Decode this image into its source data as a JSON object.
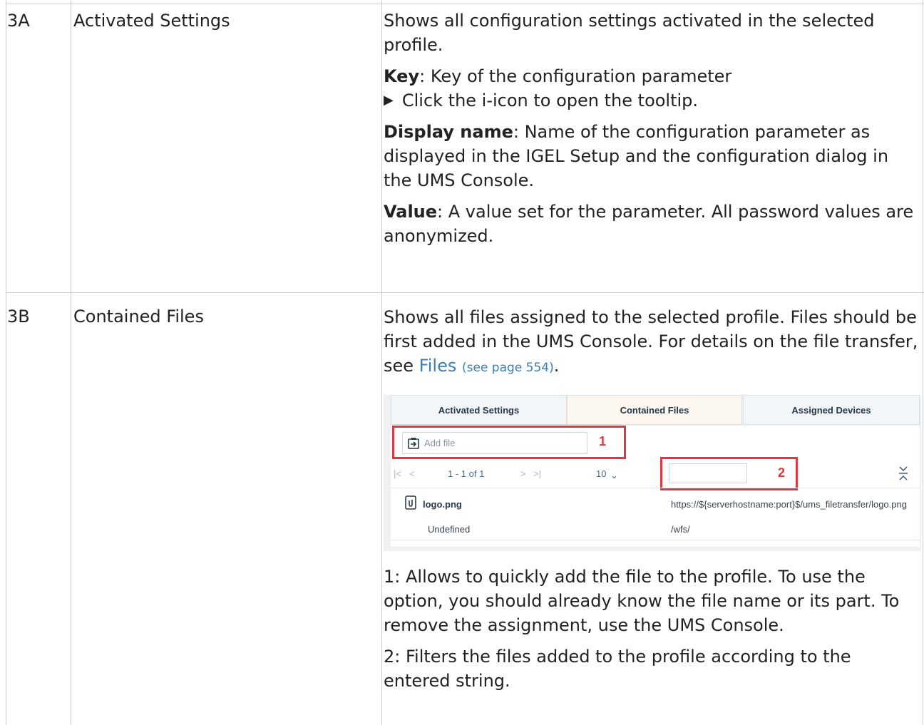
{
  "rows": [
    {
      "id": "3A",
      "name": "Activated Settings",
      "description": "Shows all configuration settings activated in the selected profile.",
      "key_label": "Key",
      "key_text": ": Key of the configuration parameter",
      "key_bullet": "Click the i-icon to open the tooltip.",
      "display_label": "Display name",
      "display_text": ": Name of the configuration parameter as displayed in the IGEL Setup and the configuration dialog in the UMS Console.",
      "value_label": "Value",
      "value_text": ": A value set for the parameter. All password values are anonymized."
    },
    {
      "id": "3B",
      "name": "Contained Files",
      "description": "Shows all files assigned to the selected profile. Files should be first added in the UMS Console. For details on the file transfer, see ",
      "link_text": "Files",
      "link_ref": "(see page 554)",
      "period": ".",
      "note1": "1: Allows to quickly add the file to the profile. To use the option, you should already know the file name or its part. To remove the assignment, use the UMS Console.",
      "note2": "2: Filters the files added to the profile according to the entered string."
    }
  ],
  "screenshot": {
    "tabs": [
      "Activated Settings",
      "Contained Files",
      "Assigned Devices"
    ],
    "active_tab": 1,
    "add_file_placeholder": "Add file",
    "callout_1": "1",
    "callout_2": "2",
    "pager_first": "|<",
    "pager_prev": "<",
    "pager_range": "1 - 1  of 1",
    "pager_next": ">",
    "pager_last": ">|",
    "page_size": "10",
    "file": {
      "name": "logo.png",
      "url": "https://${serverhostname:port}$/ums_filetransfer/logo.png",
      "type": "Undefined",
      "path": "/wfs/"
    },
    "accent_red": "#e0383d"
  }
}
